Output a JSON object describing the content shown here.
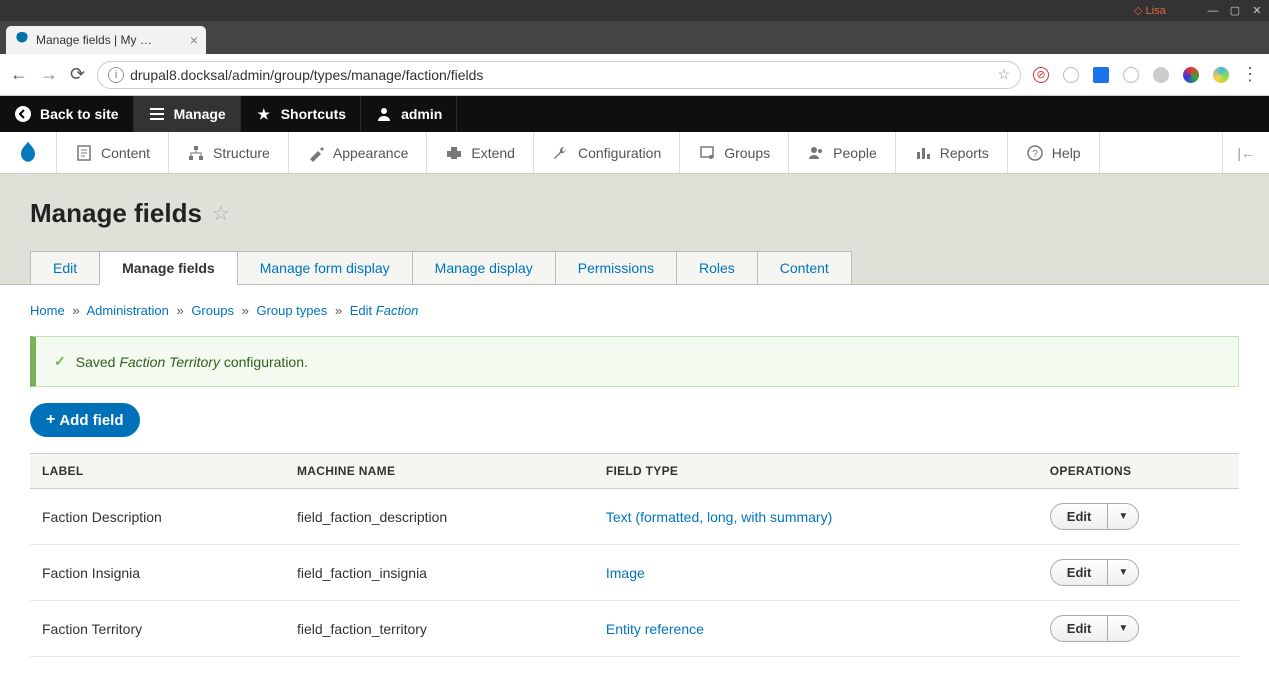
{
  "os": {
    "user": "Lisa"
  },
  "browser": {
    "tab_title": "Manage fields | My …",
    "url": "drupal8.docksal/admin/group/types/manage/faction/fields"
  },
  "toolbar": {
    "back_to_site": "Back to site",
    "manage": "Manage",
    "shortcuts": "Shortcuts",
    "user": "admin"
  },
  "admin_menu": {
    "content": "Content",
    "structure": "Structure",
    "appearance": "Appearance",
    "extend": "Extend",
    "configuration": "Configuration",
    "groups": "Groups",
    "people": "People",
    "reports": "Reports",
    "help": "Help"
  },
  "page_title": "Manage fields",
  "tabs": {
    "edit": "Edit",
    "manage_fields": "Manage fields",
    "manage_form_display": "Manage form display",
    "manage_display": "Manage display",
    "permissions": "Permissions",
    "roles": "Roles",
    "content": "Content"
  },
  "breadcrumb": {
    "home": "Home",
    "administration": "Administration",
    "groups": "Groups",
    "group_types": "Group types",
    "edit_prefix": "Edit",
    "edit_em": "Faction"
  },
  "status_message": {
    "prefix": "Saved ",
    "em": "Faction Territory",
    "suffix": " configuration."
  },
  "buttons": {
    "add_field": "Add field",
    "edit": "Edit"
  },
  "table": {
    "headers": {
      "label": "LABEL",
      "machine": "MACHINE NAME",
      "type": "FIELD TYPE",
      "ops": "OPERATIONS"
    },
    "rows": [
      {
        "label": "Faction Description",
        "machine": "field_faction_description",
        "type": "Text (formatted, long, with summary)"
      },
      {
        "label": "Faction Insignia",
        "machine": "field_faction_insignia",
        "type": "Image"
      },
      {
        "label": "Faction Territory",
        "machine": "field_faction_territory",
        "type": "Entity reference"
      }
    ]
  }
}
